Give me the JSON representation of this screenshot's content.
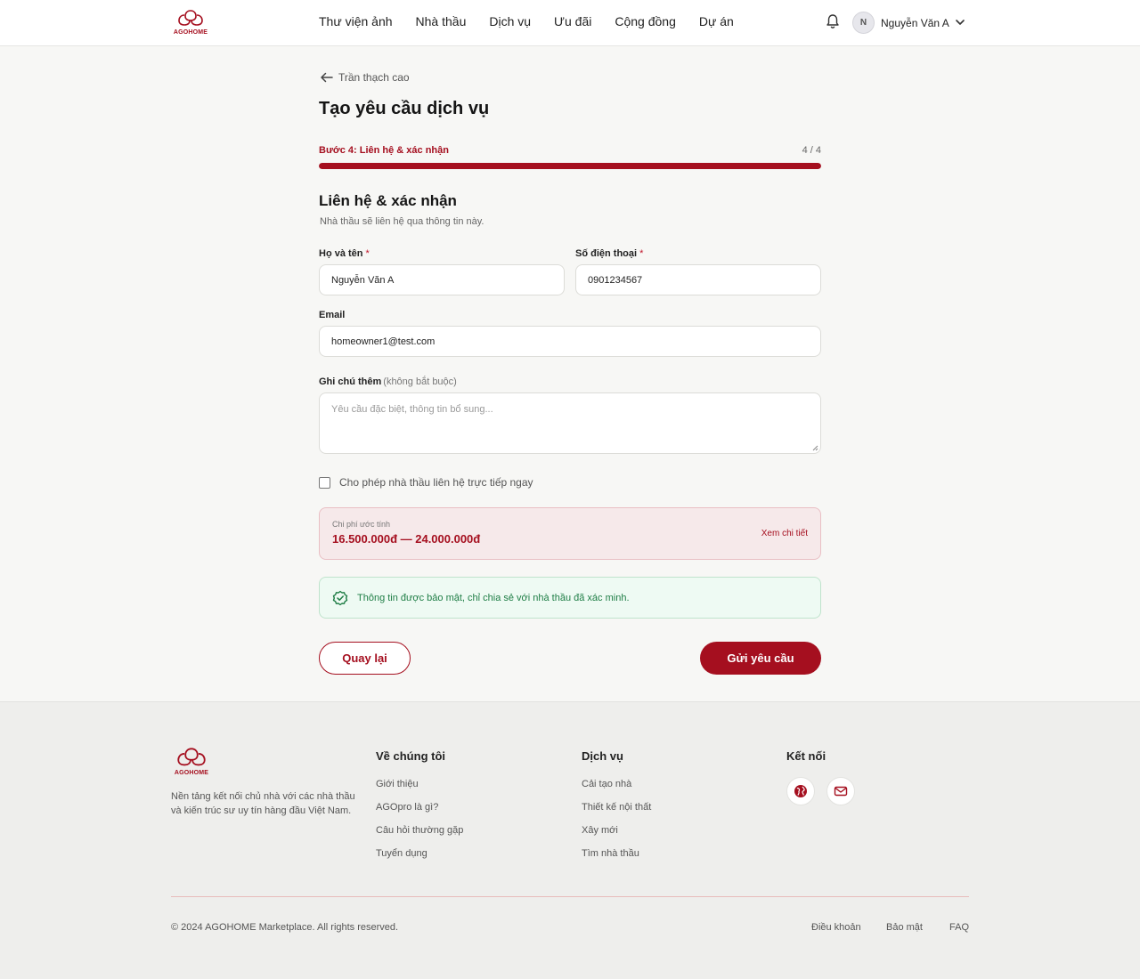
{
  "brand": {
    "name": "AGOHOME",
    "color": "#a50f1f"
  },
  "nav": {
    "items": [
      "Thư viện ảnh",
      "Nhà thầu",
      "Dịch vụ",
      "Ưu đãi",
      "Cộng đồng",
      "Dự án"
    ]
  },
  "user": {
    "initial": "N",
    "name": "Nguyễn Văn A"
  },
  "page": {
    "back_label": "Trần thạch cao",
    "title": "Tạo yêu cầu dịch vụ",
    "step_label": "Bước 4: Liên hệ & xác nhận",
    "step_count": "4 / 4",
    "progress_fraction": 1.0
  },
  "form": {
    "section_title": "Liên hệ & xác nhận",
    "section_sub": "Nhà thầu sẽ liên hệ qua thông tin này.",
    "name_label": "Họ và tên",
    "name_value": "Nguyễn Văn A",
    "phone_label": "Số điện thoại",
    "phone_value": "0901234567",
    "required_mark": "*",
    "email_label": "Email",
    "email_value": "homeowner1@test.com",
    "note_label": "Ghi chú thêm",
    "note_optional": "(không bắt buộc)",
    "note_placeholder": "Yêu cầu đặc biệt, thông tin bổ sung...",
    "allow_contact_label": "Cho phép nhà thầu liên hệ trực tiếp ngay"
  },
  "cost": {
    "label": "Chi phí ước tính",
    "value": "16.500.000đ — 24.000.000đ",
    "details_link": "Xem chi tiết"
  },
  "security_note": "Thông tin được bảo mật, chỉ chia sẻ với nhà thầu đã xác minh.",
  "actions": {
    "back": "Quay lại",
    "submit": "Gửi yêu cầu"
  },
  "footer": {
    "description": "Nền tảng kết nối chủ nhà với các nhà thầu và kiến trúc sư uy tín hàng đầu Việt Nam.",
    "about": {
      "title": "Về chúng tôi",
      "links": [
        "Giới thiệu",
        "AGOpro là gì?",
        "Câu hỏi thường gặp",
        "Tuyển dụng"
      ]
    },
    "services": {
      "title": "Dịch vụ",
      "links": [
        "Cải tạo nhà",
        "Thiết kế nội thất",
        "Xây mới",
        "Tìm nhà thầu"
      ]
    },
    "connect": {
      "title": "Kết nối",
      "icons": [
        "globe-icon",
        "mail-icon"
      ]
    },
    "copyright": "© 2024 AGOHOME Marketplace. All rights reserved.",
    "legal": [
      "Điều khoản",
      "Bảo mật",
      "FAQ"
    ]
  }
}
